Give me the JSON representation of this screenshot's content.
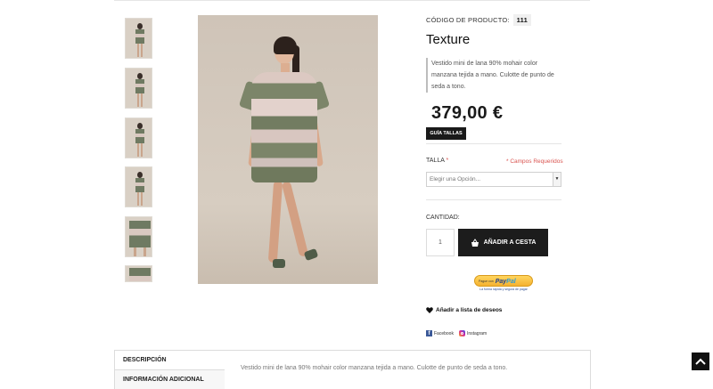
{
  "product": {
    "code_label": "CÓDIGO DE PRODUCTO:",
    "code_value": "111",
    "title": "Texture",
    "short_description": "Vestido mini de lana 90% mohair color manzana tejida a mano. Culotte de punto de seda a tono.",
    "price": "379,00 €",
    "size_guide_label": "GUÍA TALLAS"
  },
  "gallery": {
    "thumbnail_count": 6
  },
  "options": {
    "size_label": "TALLA",
    "required_star": "*",
    "required_note": "* Campos Requeridos",
    "size_select_value": "Elegir una Opción..."
  },
  "purchase": {
    "quantity_label": "CANTIDAD:",
    "quantity_value": "1",
    "add_to_cart_label": "AÑADIR A CESTA",
    "paypal_small": "Pague con",
    "paypal_brand_1": "Pay",
    "paypal_brand_2": "Pal",
    "paypal_tagline": "La forma rápida y segura de pagar",
    "wishlist_label": "Añadir a lista de deseos"
  },
  "social": {
    "facebook": "Facebook",
    "instagram": "Instagram"
  },
  "tabs": {
    "description": "DESCRIPCIÓN",
    "additional_info": "INFORMACIÓN ADICIONAL",
    "description_text": "Vestido mini de lana 90% mohair color manzana tejida a mano. Culotte de punto de seda a tono."
  },
  "icons": {
    "cart": "basket-icon",
    "wishlist": "heart-icon",
    "scroll_top": "chevron-up-icon"
  },
  "colors": {
    "dark": "#1c1c1c",
    "required": "#d9534f"
  }
}
